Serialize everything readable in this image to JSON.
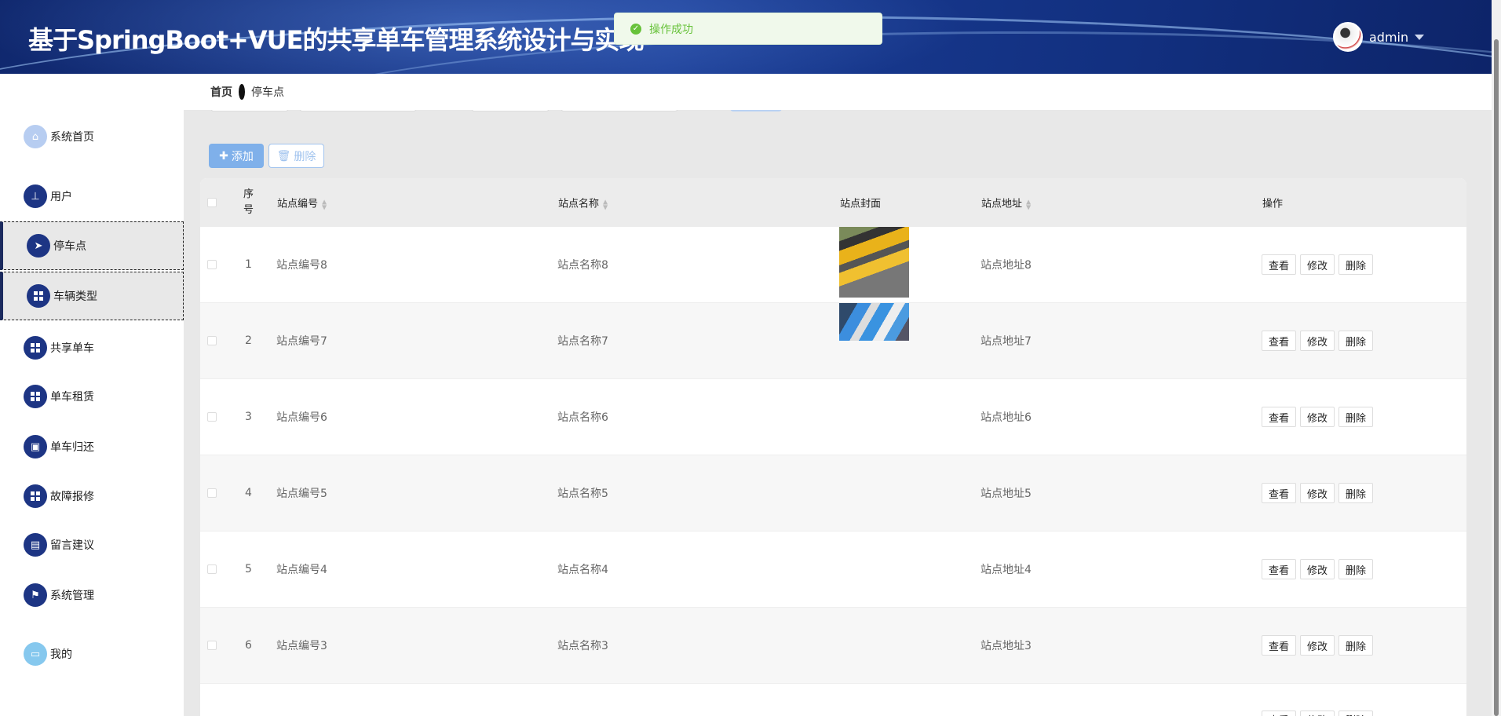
{
  "header": {
    "title": "基于SpringBoot+VUE的共享单车管理系统设计与实现",
    "username": "admin"
  },
  "toast": {
    "message": "操作成功",
    "type": "success"
  },
  "breadcrumb": {
    "home": "首页",
    "current": "停车点"
  },
  "sidebar": {
    "items": [
      {
        "label": "系统首页",
        "icon": "home-icon"
      },
      {
        "label": "用户",
        "icon": "user-icon"
      },
      {
        "label": "停车点",
        "icon": "paper-plane-icon",
        "active": true
      },
      {
        "label": "车辆类型",
        "icon": "grid-icon",
        "hover": true
      },
      {
        "label": "共享单车",
        "icon": "grid-icon"
      },
      {
        "label": "单车租赁",
        "icon": "grid-icon"
      },
      {
        "label": "单车归还",
        "icon": "briefcase-icon"
      },
      {
        "label": "故障报修",
        "icon": "grid-icon"
      },
      {
        "label": "留言建议",
        "icon": "clipboard-icon"
      },
      {
        "label": "系统管理",
        "icon": "flag-icon"
      },
      {
        "label": "我的",
        "icon": "card-icon"
      }
    ]
  },
  "toolbar": {
    "add_label": "添加",
    "delete_label": "删除"
  },
  "table": {
    "columns": {
      "index": "序号",
      "code": "站点编号",
      "name": "站点名称",
      "cover": "站点封面",
      "address": "站点地址",
      "actions": "操作"
    },
    "actions": {
      "view": "查看",
      "edit": "修改",
      "delete": "删除"
    },
    "rows": [
      {
        "index": "1",
        "code": "站点编号8",
        "name": "站点名称8",
        "address": "站点地址8",
        "cover": "yellow-bikes"
      },
      {
        "index": "2",
        "code": "站点编号7",
        "name": "站点名称7",
        "address": "站点地址7",
        "cover": "blue-bikes"
      },
      {
        "index": "3",
        "code": "站点编号6",
        "name": "站点名称6",
        "address": "站点地址6"
      },
      {
        "index": "4",
        "code": "站点编号5",
        "name": "站点名称5",
        "address": "站点地址5"
      },
      {
        "index": "5",
        "code": "站点编号4",
        "name": "站点名称4",
        "address": "站点地址4"
      },
      {
        "index": "6",
        "code": "站点编号3",
        "name": "站点名称3",
        "address": "站点地址3"
      }
    ]
  },
  "colors": {
    "header": "#1a3c94",
    "sidebar_icon": "#1d3584",
    "success": "#67c23a",
    "add_button": "#7fb0ea"
  }
}
